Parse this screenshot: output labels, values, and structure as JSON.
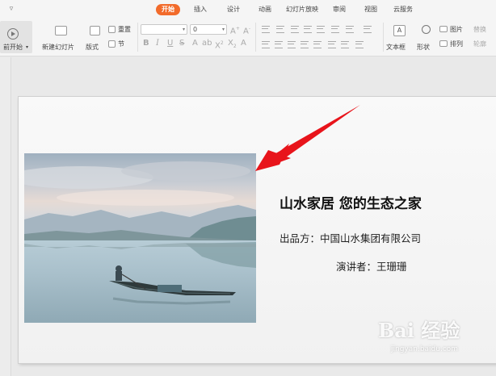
{
  "menubar": {
    "tabs": [
      {
        "label": "开始",
        "active": true
      },
      {
        "label": "插入",
        "active": false
      },
      {
        "label": "设计",
        "active": false
      },
      {
        "label": "动画",
        "active": false
      },
      {
        "label": "幻灯片放映",
        "active": false
      },
      {
        "label": "审阅",
        "active": false
      },
      {
        "label": "视图",
        "active": false
      },
      {
        "label": "云服务",
        "active": false
      }
    ],
    "accent": "#f26b2b"
  },
  "ribbon": {
    "play_from_current": "前开始",
    "new_slide": "新建幻灯片",
    "layout": "版式",
    "reset": "重置",
    "section": "节",
    "font_size_value": "0",
    "textbox": "文本框",
    "shape": "形状",
    "picture": "图片",
    "arrange": "排列",
    "replace": "替换",
    "outline": "轮廓"
  },
  "slide": {
    "title": "山水家居 您的生态之家",
    "producer_line": "出品方：中国山水集团有限公司",
    "speaker_line": "演讲者：王珊珊",
    "arrow_color": "#e8141b"
  },
  "watermark": {
    "brand": "Bai 经验",
    "url": "jingyan.baidu.com"
  }
}
